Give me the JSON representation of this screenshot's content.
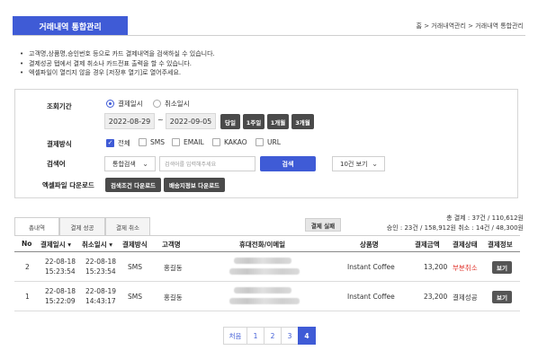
{
  "header": {
    "title": "거래내역 통합관리",
    "breadcrumb": "홈 > 거래내역관리 > 거래내역 통합관리"
  },
  "notes": [
    "고객명,상품명,승인번호 등으로 카드 결제내역을 검색하실 수 있습니다.",
    "결제성공 탭에서 결제 취소나 카드전표 출력을 할 수 있습니다.",
    "엑셀파일이 열리지 않을 경우 [저장후 열기]로 열어주세요."
  ],
  "filter": {
    "period_label": "조회기간",
    "radio_payment_date": "결제일시",
    "radio_cancel_date": "취소일시",
    "start_date": "2022-08-29",
    "date_sep": "~",
    "end_date": "2022-09-05",
    "quick_buttons": [
      "당일",
      "1주일",
      "1개월",
      "3개월"
    ],
    "method_label": "결제방식",
    "methods": [
      {
        "label": "전체",
        "checked": true
      },
      {
        "label": "SMS",
        "checked": false
      },
      {
        "label": "EMAIL",
        "checked": false
      },
      {
        "label": "KAKAO",
        "checked": false
      },
      {
        "label": "URL",
        "checked": false
      }
    ],
    "search_label": "검색어",
    "search_scope": "통합검색",
    "search_placeholder": "검색어를 입력해주세요",
    "search_button": "검색",
    "page_size": "10건 보기",
    "excel_label": "엑셀파일 다운로드",
    "excel_btn_1": "검색조건 다운로드",
    "excel_btn_2": "배송지정보 다운로드"
  },
  "result_tabs": [
    "총내역",
    "결제 성공",
    "결제 취소"
  ],
  "fail_button": "결제 실패",
  "summary": {
    "line1": "총 결제 : 37건 / 110,612원",
    "line2": "승인 : 23건 / 158,912원   취소 : 14건 / 48,300원"
  },
  "table": {
    "headers": [
      "No",
      "결제일시 ▾",
      "취소일시 ▾",
      "결제방식",
      "고객명",
      "휴대전화/이메일",
      "상품명",
      "결제금액",
      "결제상태",
      "결제정보"
    ],
    "rows": [
      {
        "no": "2",
        "pay_date": "22-08-18",
        "pay_time": "15:23:54",
        "cancel_date": "22-08-18",
        "cancel_time": "15:23:54",
        "method": "SMS",
        "customer": "홍길동",
        "product": "Instant Coffee",
        "amount": "13,200",
        "status": "부분취소",
        "detail": "보기"
      },
      {
        "no": "1",
        "pay_date": "22-08-18",
        "pay_time": "15:22:09",
        "cancel_date": "22-08-19",
        "cancel_time": "14:43:17",
        "method": "SMS",
        "customer": "홍길동",
        "product": "Instant Coffee",
        "amount": "23,200",
        "status": "결제성공",
        "detail": "보기"
      }
    ]
  },
  "pagination": {
    "first": "처음",
    "pages": [
      "1",
      "2",
      "3",
      "4"
    ],
    "active": "4"
  },
  "colors": {
    "accent": "#3f5bd6",
    "dark_button": "#4a4a4a",
    "status_partial_cancel": "#e0342c"
  }
}
